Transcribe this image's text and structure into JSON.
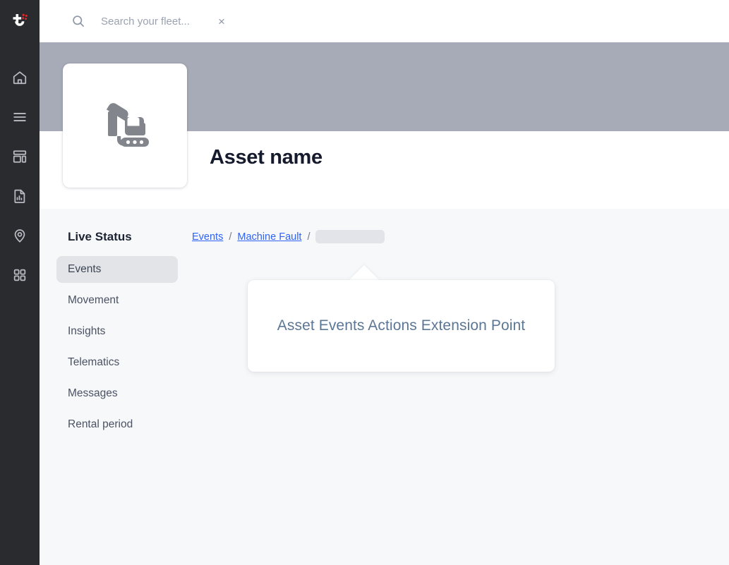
{
  "colors": {
    "rail_bg": "#2a2b2e",
    "hero_band": "#a7abb7",
    "content_bg": "#f7f8fa",
    "accent_link": "#2f62f5",
    "active_item_bg": "#e2e4e8",
    "title_text": "#151b2c",
    "ext_text": "#5c7795",
    "skeleton": "#e2e4e9",
    "logo_dot": "#e8252a"
  },
  "rail": {
    "logo_name": "telematics-logo",
    "items": [
      {
        "icon": "home-icon",
        "label": "Home"
      },
      {
        "icon": "list-icon",
        "label": "List"
      },
      {
        "icon": "dashboard-icon",
        "label": "Dashboard"
      },
      {
        "icon": "report-icon",
        "label": "Reports"
      },
      {
        "icon": "location-pin-icon",
        "label": "Map"
      },
      {
        "icon": "grid-apps-icon",
        "label": "Apps"
      }
    ]
  },
  "search": {
    "icon": "search-icon",
    "placeholder": "Search your fleet...",
    "value": "",
    "clear_icon": "close-icon",
    "clear_glyph": "×"
  },
  "hero": {
    "asset_image_icon": "excavator-icon",
    "title": "Asset name"
  },
  "subnav": {
    "title": "Live Status",
    "items": [
      {
        "label": "Events",
        "active": true
      },
      {
        "label": "Movement",
        "active": false
      },
      {
        "label": "Insights",
        "active": false
      },
      {
        "label": "Telematics",
        "active": false
      },
      {
        "label": "Messages",
        "active": false
      },
      {
        "label": "Rental period",
        "active": false
      }
    ]
  },
  "breadcrumb": {
    "items": [
      {
        "label": "Events",
        "type": "link"
      },
      {
        "label": "Machine Fault",
        "type": "link"
      },
      {
        "label": "",
        "type": "skeleton"
      }
    ],
    "separator": "/"
  },
  "extension_card": {
    "text": "Asset Events Actions Extension Point"
  }
}
